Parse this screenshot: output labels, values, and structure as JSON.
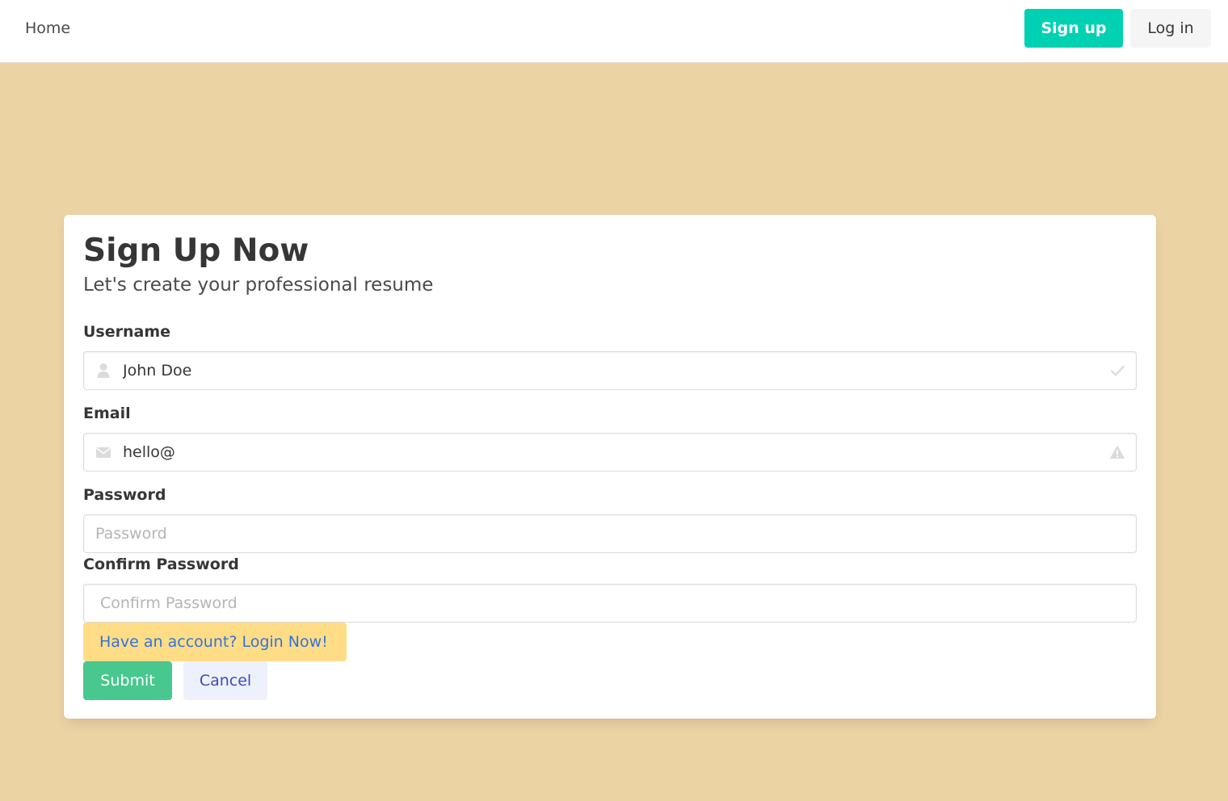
{
  "navbar": {
    "home_label": "Home",
    "signup_label": "Sign up",
    "login_label": "Log in"
  },
  "form": {
    "title": "Sign Up Now",
    "subtitle": "Let's create your professional resume",
    "username": {
      "label": "Username",
      "value": "John Doe",
      "status": "valid"
    },
    "email": {
      "label": "Email",
      "value": "hello@",
      "status": "warning"
    },
    "password": {
      "label": "Password",
      "placeholder": "Password",
      "value": ""
    },
    "confirm_password": {
      "label": "Confirm Password",
      "placeholder": "Confirm Password",
      "value": ""
    },
    "account_link": "Have an account? Login Now!",
    "submit_label": "Submit",
    "cancel_label": "Cancel"
  },
  "icons": {
    "username_left": "user-icon",
    "username_right": "check-icon",
    "email_left": "envelope-icon",
    "email_right": "warning-icon"
  },
  "colors": {
    "page_background": "#ecd3a4",
    "primary": "#00d1b2",
    "success": "#48c78e",
    "warning_light": "#ffdd87",
    "link": "#3273dc",
    "cancel_text": "#3850b7",
    "cancel_background": "#eef1fb"
  }
}
